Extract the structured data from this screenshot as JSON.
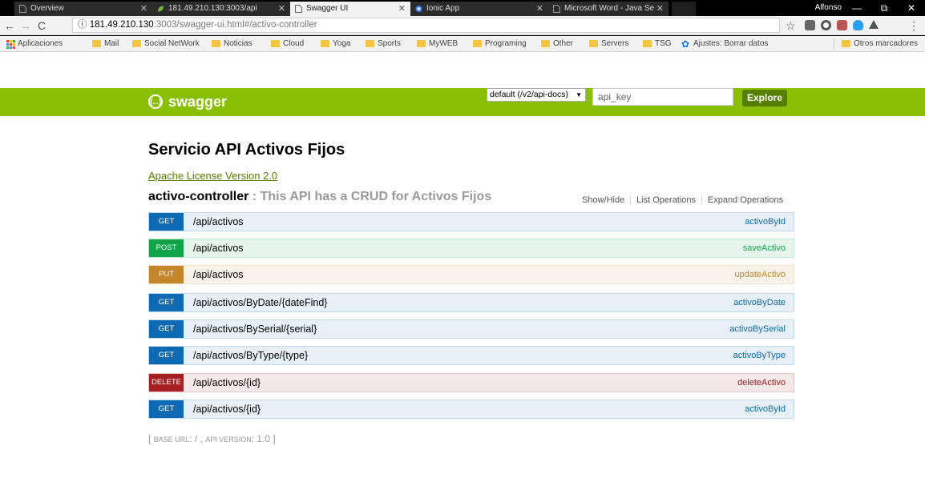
{
  "browser": {
    "tabs": [
      {
        "title": "Overview",
        "active": false
      },
      {
        "title": "181.49.210.130:3003/api",
        "active": false
      },
      {
        "title": "Swagger UI",
        "active": true
      },
      {
        "title": "Ionic App",
        "active": false
      },
      {
        "title": "Microsoft Word - Java Se",
        "active": false
      }
    ],
    "user": "Alfonso",
    "window_controls": {
      "minimize": "—",
      "restore": "⧉",
      "close": "✕"
    },
    "address": {
      "info_icon": "ⓘ",
      "host": "181.49.210.130",
      "path": ":3003/swagger-ui.html#/activo-controller"
    },
    "bookmarks": [
      "Aplicaciones",
      "Mail",
      "Social NetWork",
      "Noticias",
      "Cloud",
      "Yoga",
      "Sports",
      "MyWEB",
      "Programing",
      "Other",
      "Servers",
      "TSG",
      "Ajustes: Borrar datos"
    ],
    "other_bookmarks": "Otros marcadores"
  },
  "swagger": {
    "brand": "swagger",
    "logo_glyph": "{...}",
    "spec_select": "default (/v2/api-docs)",
    "api_key_placeholder": "api_key",
    "explore_label": "Explore",
    "title": "Servicio API Activos Fijos",
    "license": "Apache License Version 2.0",
    "controller": {
      "name": "activo-controller",
      "description": " : This API has a CRUD for Activos Fijos",
      "actions": [
        "Show/Hide",
        "List Operations",
        "Expand Operations"
      ]
    },
    "operations": [
      {
        "method": "GET",
        "path": "/api/activos",
        "nickname": "activoById"
      },
      {
        "method": "POST",
        "path": "/api/activos",
        "nickname": "saveActivo"
      },
      {
        "method": "PUT",
        "path": "/api/activos",
        "nickname": "updateActivo"
      },
      {
        "method": "GET",
        "path": "/api/activos/ByDate/{dateFind}",
        "nickname": "activoByDate"
      },
      {
        "method": "GET",
        "path": "/api/activos/BySerial/{serial}",
        "nickname": "activoBySerial"
      },
      {
        "method": "GET",
        "path": "/api/activos/ByType/{type}",
        "nickname": "activoByType"
      },
      {
        "method": "DELETE",
        "path": "/api/activos/{id}",
        "nickname": "deleteActivo"
      },
      {
        "method": "GET",
        "path": "/api/activos/{id}",
        "nickname": "activoById"
      }
    ],
    "footer": {
      "open": "[ ",
      "base_url_label": "base url",
      "base_url_value": ": / , ",
      "api_version_label": "api version",
      "api_version_value": ": 1.0 ]"
    }
  }
}
